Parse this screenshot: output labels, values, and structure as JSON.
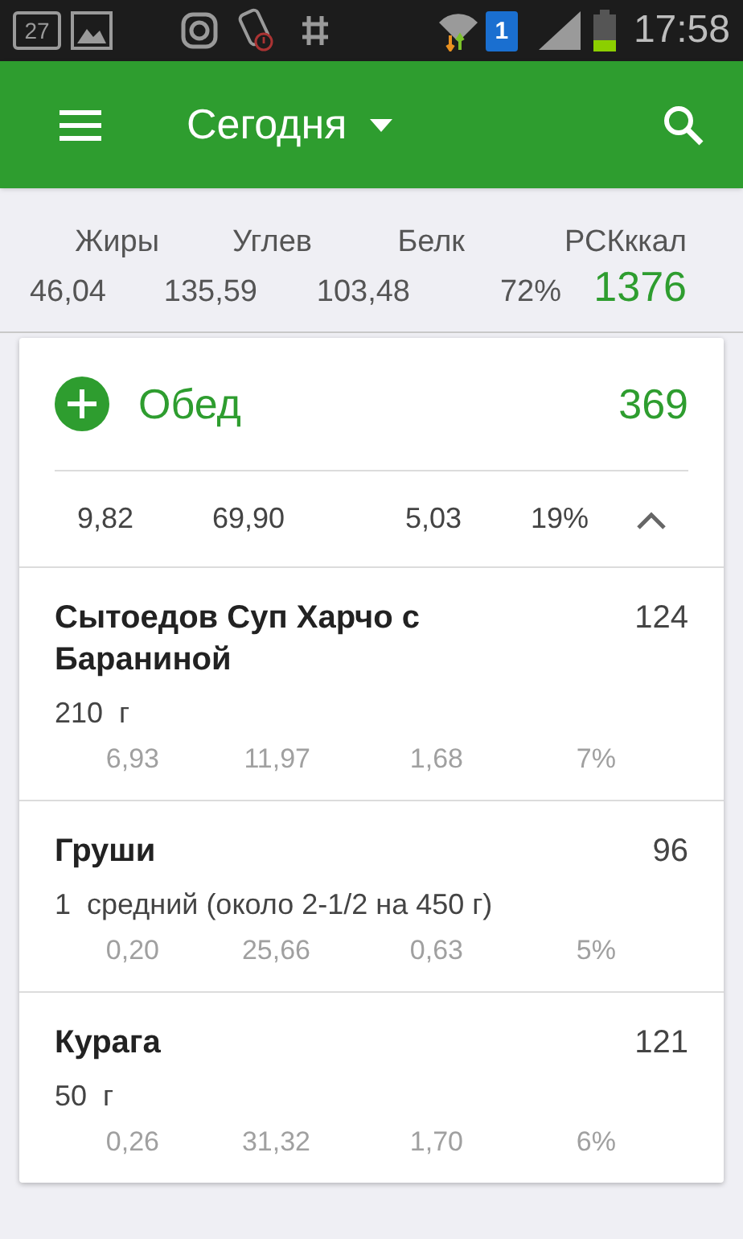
{
  "status_bar": {
    "calendar_day": "27",
    "sim": "1",
    "time": "17:58"
  },
  "toolbar": {
    "title": "Сегодня"
  },
  "summary": {
    "labels": [
      "Жиры",
      "Углев",
      "Белк",
      "РСКккал"
    ],
    "values": [
      "46,04",
      "135,59",
      "103,48",
      "72%"
    ],
    "total": "1376"
  },
  "meal": {
    "name": "Обед",
    "calories": "369",
    "expanded": true,
    "totals": [
      "9,82",
      "69,90",
      "5,03",
      "19%"
    ],
    "items": [
      {
        "name": "Сытоедов Суп Харчо с Бараниной",
        "calories": "124",
        "serving": "210  г",
        "nutrients": [
          "6,93",
          "11,97",
          "1,68",
          "7%"
        ]
      },
      {
        "name": "Груши",
        "calories": "96",
        "serving": "1  средний (около 2-1/2 на 450 г)",
        "nutrients": [
          "0,20",
          "25,66",
          "0,63",
          "5%"
        ]
      },
      {
        "name": "Курага",
        "calories": "121",
        "serving": "50  г",
        "nutrients": [
          "0,26",
          "31,32",
          "1,70",
          "6%"
        ]
      }
    ]
  }
}
